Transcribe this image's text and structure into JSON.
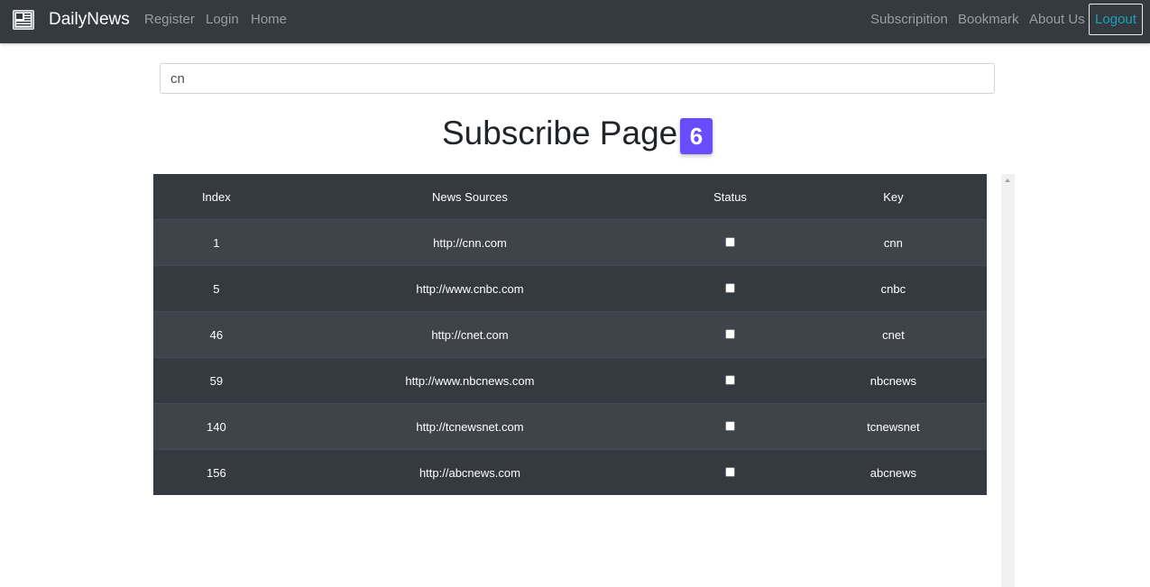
{
  "navbar": {
    "brand": "DailyNews",
    "brand_icon": "newspaper-icon",
    "left_links": [
      "Register",
      "Login",
      "Home"
    ],
    "right_links": [
      "Subscripition",
      "Bookmark",
      "About Us"
    ],
    "logout_label": "Logout"
  },
  "search": {
    "value": "cn"
  },
  "page": {
    "title": "Subscribe Page:",
    "count": "6",
    "badge_color": "#6a4cff"
  },
  "table": {
    "headers": [
      "Index",
      "News Sources",
      "Status",
      "Key"
    ],
    "rows": [
      {
        "index": "1",
        "source": "http://cnn.com",
        "status": false,
        "key": "cnn"
      },
      {
        "index": "5",
        "source": "http://www.cnbc.com",
        "status": false,
        "key": "cnbc"
      },
      {
        "index": "46",
        "source": "http://cnet.com",
        "status": false,
        "key": "cnet"
      },
      {
        "index": "59",
        "source": "http://www.nbcnews.com",
        "status": false,
        "key": "nbcnews"
      },
      {
        "index": "140",
        "source": "http://tcnewsnet.com",
        "status": false,
        "key": "tcnewsnet"
      },
      {
        "index": "156",
        "source": "http://abcnews.com",
        "status": false,
        "key": "abcnews"
      }
    ]
  }
}
